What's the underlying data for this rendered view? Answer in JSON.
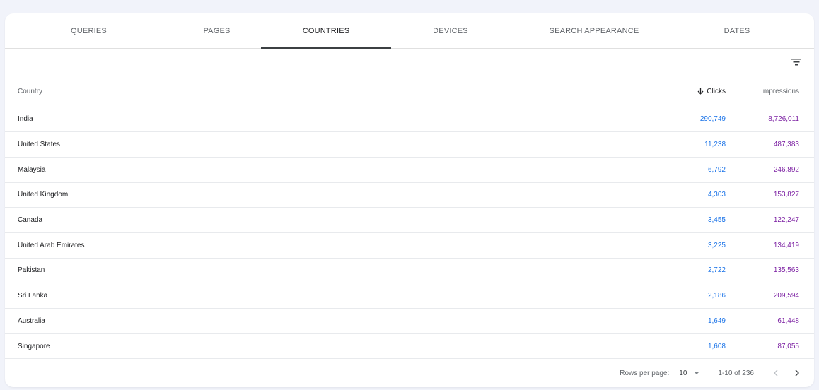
{
  "tabs": [
    {
      "label": "QUERIES",
      "active": false
    },
    {
      "label": "PAGES",
      "active": false
    },
    {
      "label": "COUNTRIES",
      "active": true
    },
    {
      "label": "DEVICES",
      "active": false
    },
    {
      "label": "SEARCH APPEARANCE",
      "active": false
    },
    {
      "label": "DATES",
      "active": false
    }
  ],
  "toolbar": {
    "filter_icon": "filter-list-icon"
  },
  "table": {
    "headers": {
      "country": "Country",
      "clicks": "Clicks",
      "impressions": "Impressions"
    },
    "sort_icon": "arrow-down-icon",
    "rows": [
      {
        "country": "India",
        "clicks": "290,749",
        "impressions": "8,726,011"
      },
      {
        "country": "United States",
        "clicks": "11,238",
        "impressions": "487,383"
      },
      {
        "country": "Malaysia",
        "clicks": "6,792",
        "impressions": "246,892"
      },
      {
        "country": "United Kingdom",
        "clicks": "4,303",
        "impressions": "153,827"
      },
      {
        "country": "Canada",
        "clicks": "3,455",
        "impressions": "122,247"
      },
      {
        "country": "United Arab Emirates",
        "clicks": "3,225",
        "impressions": "134,419"
      },
      {
        "country": "Pakistan",
        "clicks": "2,722",
        "impressions": "135,563"
      },
      {
        "country": "Sri Lanka",
        "clicks": "2,186",
        "impressions": "209,594"
      },
      {
        "country": "Australia",
        "clicks": "1,649",
        "impressions": "61,448"
      },
      {
        "country": "Singapore",
        "clicks": "1,608",
        "impressions": "87,055"
      }
    ]
  },
  "footer": {
    "rows_per_page_label": "Rows per page:",
    "rows_per_page_value": "10",
    "range": "1-10 of 236"
  },
  "colors": {
    "clicks": "#1a73e8",
    "impressions": "#7b1fa2",
    "active_tab_indicator": "#3c4043"
  }
}
